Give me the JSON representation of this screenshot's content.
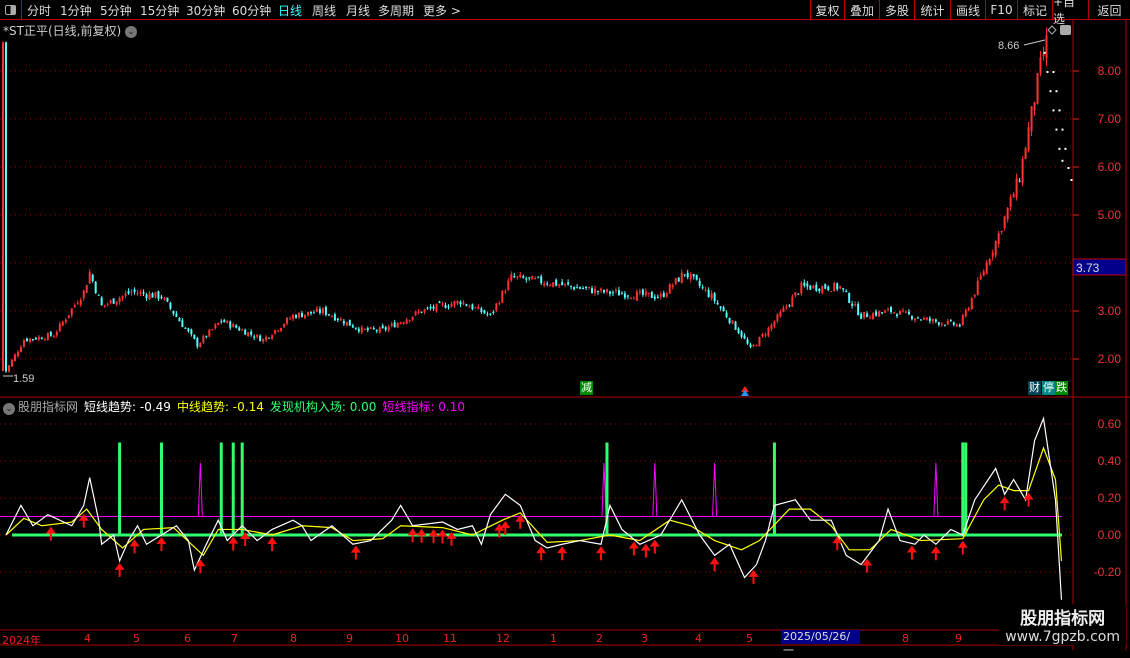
{
  "toolbar": {
    "periods": [
      "分时",
      "1分钟",
      "5分钟",
      "15分钟",
      "30分钟",
      "60分钟",
      "日线",
      "周线",
      "月线",
      "多周期",
      "更多 >"
    ],
    "active": "日线",
    "right_buttons": [
      "复权",
      "叠加",
      "多股",
      "统计",
      "画线",
      "F10",
      "标记",
      "+自选",
      "返回"
    ]
  },
  "title": "*ST正平(日线,前复权)",
  "price_panel": {
    "high_label": "8.66",
    "low_label": "1.59",
    "current_price": "3.73",
    "y_ticks": [
      "8.00",
      "7.00",
      "6.00",
      "5.00",
      "3.00",
      "2.00"
    ],
    "badges": {
      "reduce": "减",
      "finance": "财",
      "halt": "停",
      "fall": "跌"
    }
  },
  "indicator_header": {
    "name": "股朋指标网",
    "short": "短线趋势: -0.49",
    "mid": "中线趋势: -0.14",
    "inst": "发现机构入场: 0.00",
    "sig": "短线指标: 0.10"
  },
  "indicator_ticks": [
    "0.60",
    "0.40",
    "0.20",
    "0.00",
    "-0.20"
  ],
  "x_axis": {
    "labels": [
      "2024年",
      "4",
      "5",
      "6",
      "7",
      "8",
      "9",
      "10",
      "11",
      "12",
      "1",
      "2",
      "3",
      "4",
      "5",
      "8",
      "9"
    ],
    "cursor_date": "2025/05/26/一"
  },
  "watermark": {
    "line1": "股朋指标网",
    "line2": "www.7gpzb.com"
  },
  "colors": {
    "up": "#ff3232",
    "down": "#54ffff",
    "grid": "#b00000",
    "short": "#ffffff",
    "mid": "#ffff00",
    "inst": "#32ff6e",
    "sig": "#ff00ff",
    "arrow": "#ff1010"
  },
  "chart_data": [
    {
      "type": "candlestick",
      "title": "*ST正平 日线",
      "ylim": [
        1.3,
        8.9
      ],
      "y_ticks": [
        2,
        3,
        4,
        5,
        6,
        7,
        8
      ],
      "close_path": [
        [
          1,
          1.75
        ],
        [
          7,
          2.4
        ],
        [
          17,
          2.5
        ],
        [
          27,
          3.4
        ],
        [
          29,
          3.8
        ],
        [
          33,
          3.1
        ],
        [
          43,
          3.4
        ],
        [
          53,
          3.3
        ],
        [
          65,
          2.3
        ],
        [
          73,
          2.8
        ],
        [
          87,
          2.4
        ],
        [
          97,
          2.9
        ],
        [
          107,
          3.0
        ],
        [
          120,
          2.6
        ],
        [
          127,
          2.6
        ],
        [
          140,
          3.0
        ],
        [
          153,
          3.2
        ],
        [
          163,
          2.9
        ],
        [
          170,
          3.7
        ],
        [
          182,
          3.6
        ],
        [
          200,
          3.4
        ],
        [
          220,
          3.3
        ],
        [
          228,
          3.8
        ],
        [
          237,
          3.3
        ],
        [
          247,
          2.5
        ],
        [
          250,
          2.2
        ],
        [
          257,
          2.7
        ],
        [
          267,
          3.5
        ],
        [
          280,
          3.5
        ],
        [
          287,
          2.9
        ],
        [
          297,
          3.0
        ],
        [
          310,
          2.8
        ],
        [
          320,
          2.7
        ],
        [
          325,
          3.4
        ],
        [
          333,
          4.6
        ],
        [
          340,
          5.8
        ],
        [
          347,
          8.1
        ],
        [
          349,
          8.6
        ]
      ],
      "high": 8.66,
      "low": 1.59,
      "projection_dots": [
        [
          349,
          8.0
        ],
        [
          350,
          7.6
        ],
        [
          351,
          7.2
        ],
        [
          352,
          6.8
        ],
        [
          353,
          6.4
        ],
        [
          354,
          6.0
        ],
        [
          355,
          5.75
        ]
      ]
    },
    {
      "type": "line",
      "title": "股朋指标网",
      "ylim": [
        -0.3,
        0.75
      ],
      "y_ticks": [
        0.6,
        0.4,
        0.2,
        0,
        -0.2
      ],
      "series": [
        {
          "name": "短线趋势",
          "color": "#ffffff",
          "points": [
            [
              1,
              0
            ],
            [
              6,
              0.16
            ],
            [
              10,
              0.05
            ],
            [
              15,
              0.11
            ],
            [
              23,
              0.05
            ],
            [
              27,
              0.16
            ],
            [
              29,
              0.31
            ],
            [
              32,
              0.08
            ],
            [
              33,
              -0.05
            ],
            [
              37,
              0
            ],
            [
              39,
              -0.14
            ],
            [
              42,
              -0.03
            ],
            [
              45,
              0.05
            ],
            [
              48,
              -0.05
            ],
            [
              53,
              0
            ],
            [
              58,
              0.05
            ],
            [
              62,
              -0.03
            ],
            [
              64,
              -0.19
            ],
            [
              68,
              -0.05
            ],
            [
              72,
              0.08
            ],
            [
              75,
              -0.03
            ],
            [
              80,
              0.05
            ],
            [
              85,
              -0.03
            ],
            [
              90,
              0.03
            ],
            [
              97,
              0.08
            ],
            [
              100,
              0.05
            ],
            [
              103,
              -0.03
            ],
            [
              110,
              0.05
            ],
            [
              117,
              -0.05
            ],
            [
              123,
              -0.03
            ],
            [
              130,
              0.08
            ],
            [
              133,
              0.16
            ],
            [
              137,
              0.05
            ],
            [
              147,
              0.07
            ],
            [
              152,
              0.03
            ],
            [
              157,
              0.05
            ],
            [
              160,
              -0.05
            ],
            [
              163,
              0.11
            ],
            [
              168,
              0.22
            ],
            [
              173,
              0.16
            ],
            [
              178,
              -0.03
            ],
            [
              182,
              -0.07
            ],
            [
              187,
              -0.05
            ],
            [
              193,
              -0.03
            ],
            [
              200,
              -0.05
            ],
            [
              203,
              0.16
            ],
            [
              207,
              0.03
            ],
            [
              213,
              -0.05
            ],
            [
              220,
              0
            ],
            [
              227,
              0.19
            ],
            [
              233,
              0
            ],
            [
              238,
              -0.11
            ],
            [
              243,
              -0.05
            ],
            [
              248,
              -0.23
            ],
            [
              252,
              -0.16
            ],
            [
              255,
              -0.03
            ],
            [
              258,
              0.16
            ],
            [
              265,
              0.19
            ],
            [
              270,
              0.08
            ],
            [
              277,
              0.08
            ],
            [
              282,
              -0.11
            ],
            [
              287,
              -0.16
            ],
            [
              293,
              -0.03
            ],
            [
              296,
              0.14
            ],
            [
              300,
              -0.03
            ],
            [
              305,
              -0.05
            ],
            [
              308,
              0
            ],
            [
              312,
              -0.05
            ],
            [
              317,
              0.03
            ],
            [
              321,
              0
            ],
            [
              325,
              0.19
            ],
            [
              332,
              0.36
            ],
            [
              335,
              0.22
            ],
            [
              338,
              0.3
            ],
            [
              342,
              0.19
            ],
            [
              345,
              0.51
            ],
            [
              348,
              0.63
            ],
            [
              352,
              0.19
            ],
            [
              354,
              -0.35
            ]
          ]
        },
        {
          "name": "中线趋势",
          "color": "#ffff00",
          "points": [
            [
              1,
              0
            ],
            [
              7,
              0.09
            ],
            [
              13,
              0.05
            ],
            [
              23,
              0.07
            ],
            [
              28,
              0.14
            ],
            [
              33,
              0.03
            ],
            [
              40,
              -0.07
            ],
            [
              47,
              0.03
            ],
            [
              57,
              0.04
            ],
            [
              67,
              -0.11
            ],
            [
              72,
              0.03
            ],
            [
              80,
              0.03
            ],
            [
              90,
              0
            ],
            [
              100,
              0.05
            ],
            [
              110,
              0.04
            ],
            [
              117,
              -0.03
            ],
            [
              127,
              -0.02
            ],
            [
              133,
              0.05
            ],
            [
              147,
              0.04
            ],
            [
              157,
              0
            ],
            [
              167,
              0.08
            ],
            [
              173,
              0.12
            ],
            [
              182,
              -0.04
            ],
            [
              193,
              -0.03
            ],
            [
              203,
              0
            ],
            [
              213,
              -0.03
            ],
            [
              223,
              0.08
            ],
            [
              230,
              0.05
            ],
            [
              238,
              -0.03
            ],
            [
              247,
              -0.08
            ],
            [
              253,
              -0.03
            ],
            [
              263,
              0.14
            ],
            [
              270,
              0.14
            ],
            [
              277,
              0.05
            ],
            [
              283,
              -0.08
            ],
            [
              290,
              -0.08
            ],
            [
              297,
              0.03
            ],
            [
              307,
              -0.03
            ],
            [
              321,
              -0.02
            ],
            [
              328,
              0.19
            ],
            [
              333,
              0.27
            ],
            [
              338,
              0.24
            ],
            [
              343,
              0.24
            ],
            [
              348,
              0.47
            ],
            [
              352,
              0.3
            ],
            [
              354,
              -0.14
            ]
          ]
        },
        {
          "name": "发现机构入场",
          "color": "#32ff6e",
          "baseline": 0,
          "spikes": [
            39,
            53,
            73,
            77,
            80,
            202,
            258,
            321,
            322
          ],
          "spike_value": 0.5
        },
        {
          "name": "短线指标",
          "color": "#ff00ff",
          "baseline": 0.1,
          "spikes": [
            66,
            201,
            218,
            238,
            312
          ],
          "spike_value": 0.39
        }
      ],
      "buy_arrows": [
        16,
        27,
        39,
        44,
        53,
        66,
        77,
        81,
        90,
        118,
        137,
        140,
        144,
        147,
        150,
        166,
        168,
        173,
        180,
        187,
        200,
        211,
        215,
        218,
        238,
        251,
        279,
        289,
        304,
        312,
        321,
        335,
        343
      ]
    }
  ]
}
